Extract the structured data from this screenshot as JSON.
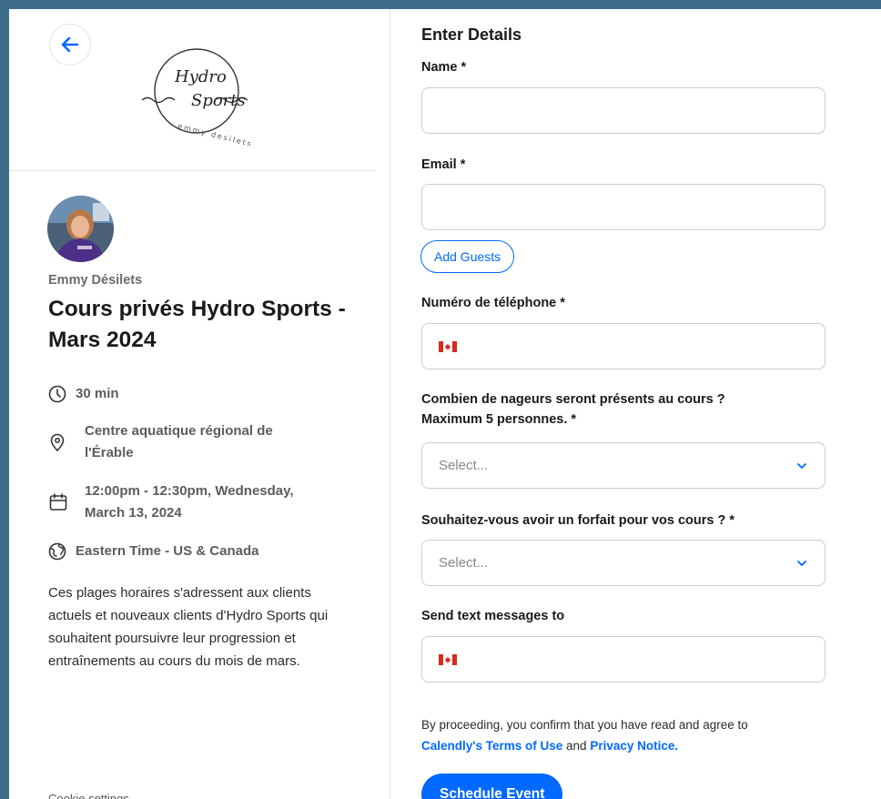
{
  "event": {
    "organizer": "Emmy Désilets",
    "title": "Cours privés Hydro Sports - Mars 2024",
    "duration": "30 min",
    "location_line1": "Centre aquatique régional de",
    "location_line2": "l'Érable",
    "datetime_line1": "12:00pm - 12:30pm, Wednesday,",
    "datetime_line2": "March 13, 2024",
    "timezone": "Eastern Time - US & Canada",
    "description": "Ces plages horaires s'adressent aux clients actuels et nouveaux clients d'Hydro Sports qui souhaitent poursuivre leur progression et entraînements au cours du mois de mars.",
    "cookie_text": "Cookie settings"
  },
  "logo": {
    "line1": "Hydro",
    "line2": "Sports",
    "subtitle": "emmy desilets"
  },
  "form": {
    "section_title": "Enter Details",
    "name_label": "Name *",
    "email_label": "Email *",
    "add_guests": "Add Guests",
    "phone_label": "Numéro de téléphone *",
    "swimmers_label_line1": "Combien de nageurs seront présents au cours ?",
    "swimmers_label_line2": "Maximum 5 personnes. *",
    "swimmers_placeholder": "Select...",
    "package_label": "Souhaitez-vous avoir un forfait pour vos cours ? *",
    "package_placeholder": "Select...",
    "sms_label": "Send text messages to",
    "terms_prefix": "By proceeding, you confirm that you have read and agree to",
    "terms_link": "Calendly's Terms of Use",
    "terms_and": "and",
    "privacy_link": "Privacy Notice.",
    "schedule_button": "Schedule Event"
  },
  "colors": {
    "accent": "#0069ff",
    "background": "#3e6d8c",
    "flag_red": "#d52b1e"
  },
  "icons": [
    "back-arrow-icon",
    "clock-icon",
    "location-pin-icon",
    "calendar-icon",
    "globe-icon",
    "canada-flag-icon",
    "chevron-down-icon"
  ]
}
